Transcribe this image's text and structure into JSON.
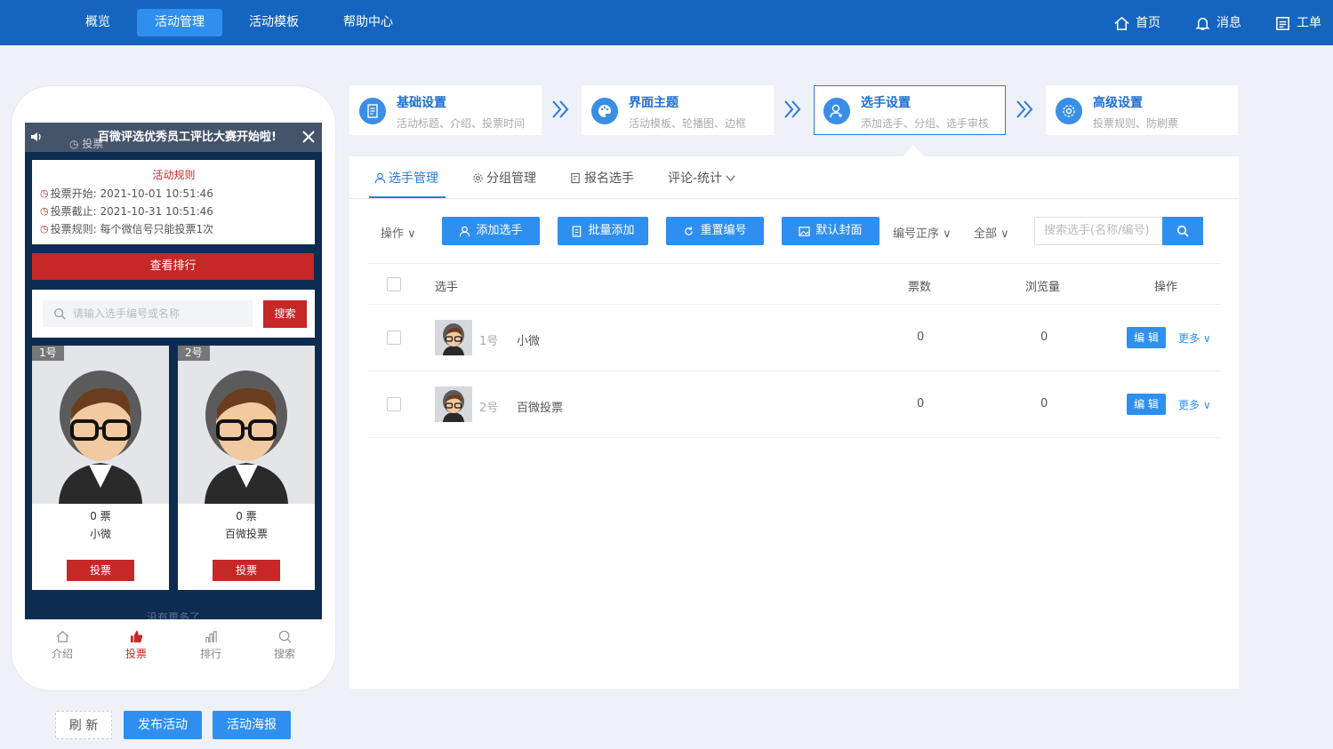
{
  "topnav": {
    "items": [
      "概览",
      "活动管理",
      "活动模板",
      "帮助中心"
    ],
    "active_index": 1,
    "right": {
      "home": "首页",
      "messages": "消息",
      "ticket": "工单"
    }
  },
  "phone": {
    "marquee": "百微评选优秀员工评比大赛开始啦!",
    "marquee_prefix": "投票",
    "rules": {
      "title": "活动规则",
      "start": "投票开始: 2021-10-01 10:51:46",
      "end": "投票截止: 2021-10-31 10:51:46",
      "rule": "投票规则: 每个微信号只能投票1次"
    },
    "rank_button": "查看排行",
    "search_placeholder": "请输入选手编号或名称",
    "search_button": "搜索",
    "cards": [
      {
        "num": "1号",
        "votes": "0 票",
        "name": "小微",
        "button": "投票"
      },
      {
        "num": "2号",
        "votes": "0 票",
        "name": "百微投票",
        "button": "投票"
      }
    ],
    "no_more": "没有更多了",
    "tabbar": [
      "介绍",
      "投票",
      "排行",
      "搜索"
    ],
    "tabbar_active": 1
  },
  "bottom_buttons": {
    "refresh": "刷 新",
    "publish": "发布活动",
    "poster": "活动海报"
  },
  "steps": [
    {
      "title": "基础设置",
      "desc": "活动标题、介绍、投票时间",
      "icon": "document-icon"
    },
    {
      "title": "界面主题",
      "desc": "活动模板、轮播图、边框",
      "icon": "palette-icon"
    },
    {
      "title": "选手设置",
      "desc": "添加选手、分组、选手审核",
      "icon": "user-add-icon"
    },
    {
      "title": "高级设置",
      "desc": "投票规则、防刷票",
      "icon": "gear-icon"
    }
  ],
  "active_step": 2,
  "panel": {
    "tabs": [
      "选手管理",
      "分组管理",
      "报名选手",
      "评论-统计"
    ],
    "active_tab": 0,
    "toolbar": {
      "ops": "操作",
      "add": "添加选手",
      "batch": "批量添加",
      "renumber": "重置编号",
      "cover": "默认封面",
      "sort": "编号正序",
      "filter": "全部",
      "search_placeholder": "搜索选手(名称/编号)"
    },
    "columns": {
      "player": "选手",
      "votes": "票数",
      "views": "浏览量",
      "ops": "操作"
    },
    "rows": [
      {
        "num": "1号",
        "name": "小微",
        "votes": "0",
        "views": "0",
        "edit": "编 辑",
        "more": "更多"
      },
      {
        "num": "2号",
        "name": "百微投票",
        "votes": "0",
        "views": "0",
        "edit": "编 辑",
        "more": "更多"
      }
    ]
  },
  "colors": {
    "brand": "#1565c0",
    "accent": "#2f8ff0",
    "vote_red": "#c62828",
    "phone_bg": "#0d2c52"
  }
}
